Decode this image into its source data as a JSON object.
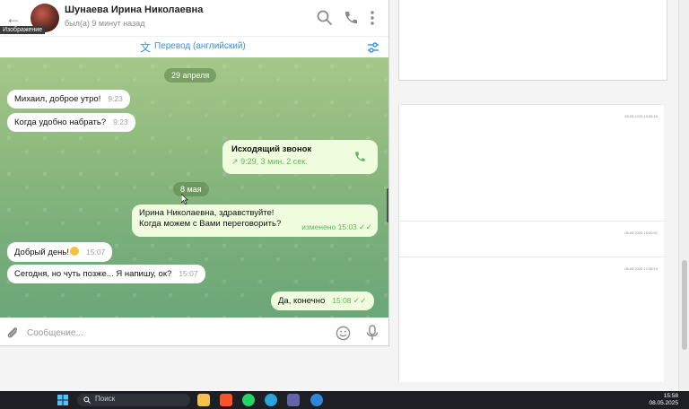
{
  "chat": {
    "contact_name": "Шунаева Ирина Николаевна",
    "status": "был(а) 9 минут назад",
    "tooltip": "Изображение",
    "translate_label": "Перевод (английский)",
    "composer_placeholder": "Сообщение..."
  },
  "messages": {
    "date1": "29 апреля",
    "date2": "8 мая",
    "m1": {
      "text": "Михаил, доброе утро!",
      "time": "9:23"
    },
    "m2": {
      "text": "Когда удобно набрать?",
      "time": "9:23"
    },
    "call": {
      "title": "Исходящий звонок",
      "details": "9:29, 3 мин. 2 сек."
    },
    "m3": {
      "line1": "Ирина Николаевна, здравствуйте!",
      "line2": "Когда можем с Вами переговорить?",
      "status": "изменено 15:03"
    },
    "m4": {
      "text": "Добрый день!",
      "time": "15:07"
    },
    "m5": {
      "text": "Сегодня, но чуть позже... Я напишу, ок?",
      "time": "15:07"
    },
    "m6": {
      "text": "Да, конечно",
      "time": "15:08"
    }
  },
  "background_doc": {
    "date1": "08.05.2025 15:58:15",
    "date2": "08.05.2025 18:00:52",
    "date3": "08.05.2025 12:38:19"
  },
  "taskbar": {
    "search_label": "Поиск",
    "time": "15:58",
    "date": "08.05.2025"
  },
  "colors": {
    "accent": "#3390ec",
    "outgoing_bubble": "#effdde",
    "check_green": "#5fb65a"
  }
}
